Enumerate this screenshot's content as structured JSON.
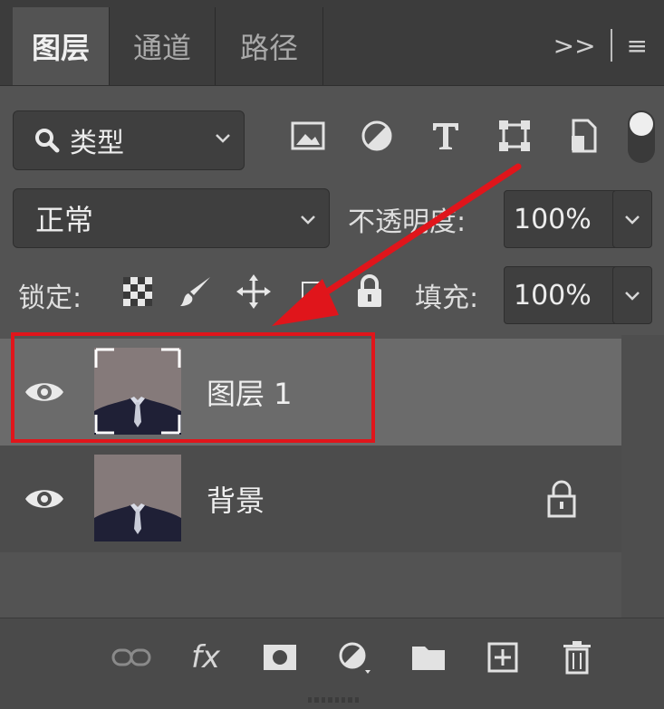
{
  "tabs": [
    {
      "label": "图层",
      "active": true
    },
    {
      "label": "通道",
      "active": false
    },
    {
      "label": "路径",
      "active": false
    }
  ],
  "panel_menu": {
    "expand": ">>",
    "menu": "≡"
  },
  "filter": {
    "label": "类型"
  },
  "filter_icons": [
    "image-filter-icon",
    "adjustment-filter-icon",
    "type-filter-icon",
    "shape-filter-icon",
    "smart-object-filter-icon"
  ],
  "blend_mode": {
    "value": "正常"
  },
  "opacity": {
    "label": "不透明度:",
    "value": "100%"
  },
  "lock": {
    "label": "锁定:"
  },
  "fill": {
    "label": "填充:",
    "value": "100%"
  },
  "layers": [
    {
      "name": "图层 1",
      "visible": true,
      "selected": true,
      "locked": false
    },
    {
      "name": "背景",
      "visible": true,
      "selected": false,
      "locked": true
    }
  ],
  "bottom_toolbar": {
    "fx": "fx"
  },
  "colors": {
    "panel_bg": "#535353",
    "selected_row": "#6b6b6b",
    "annotation_red": "#e0151b"
  }
}
